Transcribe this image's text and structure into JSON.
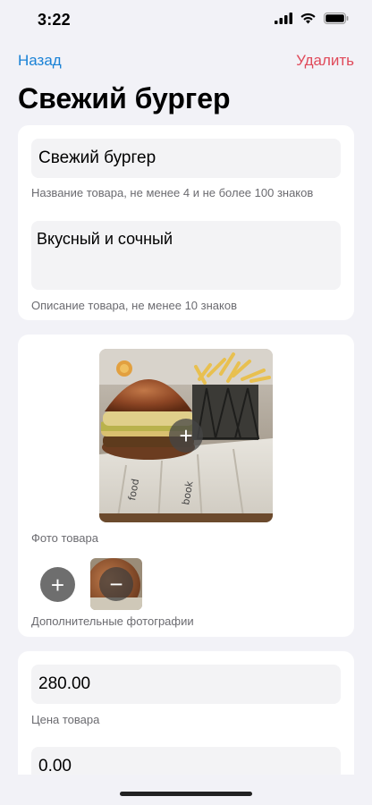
{
  "status_bar": {
    "time": "3:22"
  },
  "nav": {
    "back_label": "Назад",
    "delete_label": "Удалить"
  },
  "page": {
    "title": "Свежий бургер"
  },
  "product": {
    "name_value": "Свежий бургер",
    "name_helper": "Название товара, не менее 4 и не более 100 знаков",
    "description_value": "Вкусный и сочный",
    "description_helper": "Описание товара, не менее 10 знаков"
  },
  "photos": {
    "main_helper": "Фото товара",
    "extra_helper": "Дополнительные фотографии"
  },
  "pricing": {
    "price_value": "280.00",
    "price_helper": "Цена товара",
    "second_value": "0.00"
  },
  "colors": {
    "accent": "#1a82d6",
    "destructive": "#e04a5a",
    "background": "#f2f2f7"
  }
}
